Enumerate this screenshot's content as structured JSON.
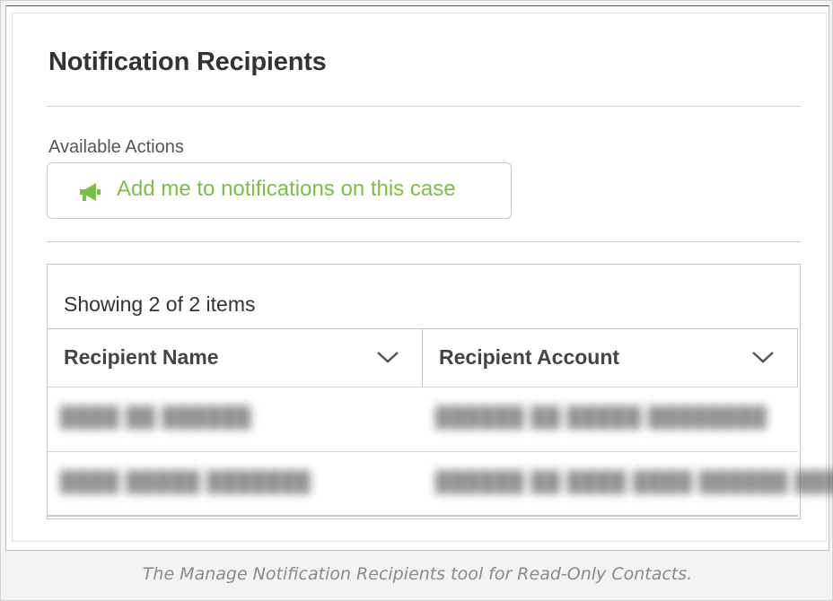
{
  "panel": {
    "title": "Notification Recipients",
    "actions_label": "Available Actions",
    "add_button": {
      "label": "Add me to notifications on this case",
      "icon": "megaphone-icon",
      "color": "#7cc043"
    }
  },
  "grid": {
    "count_text": "Showing 2 of 2 items",
    "columns": [
      {
        "label": "Recipient Name",
        "icon": "chevron-down-icon"
      },
      {
        "label": "Recipient Account",
        "icon": "chevron-down-icon"
      }
    ],
    "rows": [
      {
        "name": "████ ██ ██████",
        "account": "██████ ██ █████ ████████"
      },
      {
        "name": "████ █████ ███████",
        "account": "██████ ██ ████ ████ ██████ ███"
      }
    ]
  },
  "caption": "The Manage Notification Recipients tool for Read-Only Contacts."
}
